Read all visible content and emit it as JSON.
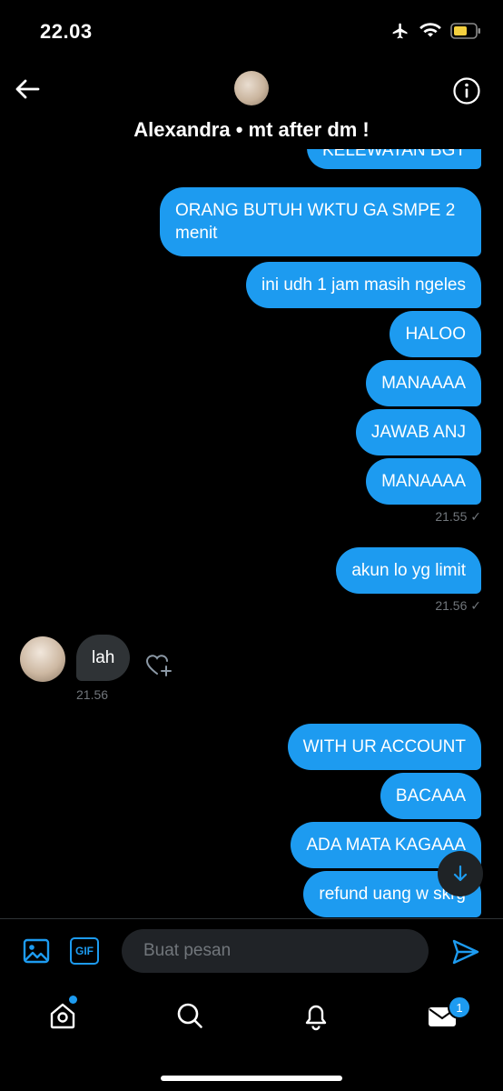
{
  "status_bar": {
    "time": "22.03"
  },
  "header": {
    "title": "Alexandra • mt after dm !"
  },
  "messages": {
    "m0": "KELEWATAN BGT",
    "m1": "ORANG BUTUH WKTU GA SMPE 2 menit",
    "m2": "ini udh 1 jam masih ngeles",
    "m3": "HALOO",
    "m4": "MANAAAA",
    "m5": "JAWAB ANJ",
    "m6": "MANAAAA",
    "ts1": "21.55 ✓",
    "m7": "akun lo yg limit",
    "ts2": "21.56 ✓",
    "r1": "lah",
    "ts3": "21.56",
    "m8": "WITH UR ACCOUNT",
    "m9": "BACAAA",
    "m10": "ADA MATA KAGAAA",
    "m11": "refund uang w skrg"
  },
  "composer": {
    "placeholder": "Buat pesan",
    "gif_label": "GIF"
  },
  "nav": {
    "messages_badge": "1"
  },
  "colors": {
    "accent": "#1d9bf0",
    "background": "#000000",
    "received_bubble": "#2f3336"
  }
}
